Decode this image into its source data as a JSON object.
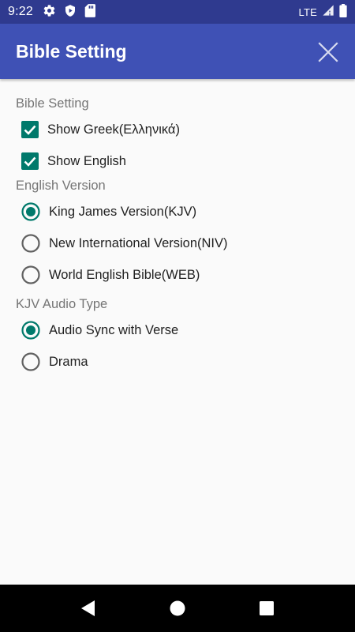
{
  "status_bar": {
    "time": "9:22",
    "network": "LTE",
    "icons_left": [
      "gear-icon",
      "play-protect-icon",
      "sd-card-icon"
    ],
    "icons_right": [
      "signal-icon",
      "battery-icon"
    ]
  },
  "app_bar": {
    "title": "Bible Setting",
    "close_icon": "close-icon"
  },
  "sections": {
    "bible_setting": {
      "header": "Bible Setting",
      "options": [
        {
          "label": "Show Greek(Ελληνικά)",
          "checked": true
        },
        {
          "label": "Show English",
          "checked": true
        }
      ]
    },
    "english_version": {
      "header": "English Version",
      "options": [
        {
          "label": "King James Version(KJV)",
          "selected": true
        },
        {
          "label": "New International Version(NIV)",
          "selected": false
        },
        {
          "label": "World English Bible(WEB)",
          "selected": false
        }
      ]
    },
    "kjv_audio_type": {
      "header": "KJV Audio Type",
      "options": [
        {
          "label": "Audio Sync with Verse",
          "selected": true
        },
        {
          "label": "Drama",
          "selected": false
        }
      ]
    }
  },
  "nav_bar": {
    "buttons": [
      "back-icon",
      "home-icon",
      "recents-icon"
    ]
  },
  "colors": {
    "primary": "#3f51b5",
    "primary_dark": "#2f3a8f",
    "accent": "#00796b",
    "unselected": "#616161"
  }
}
